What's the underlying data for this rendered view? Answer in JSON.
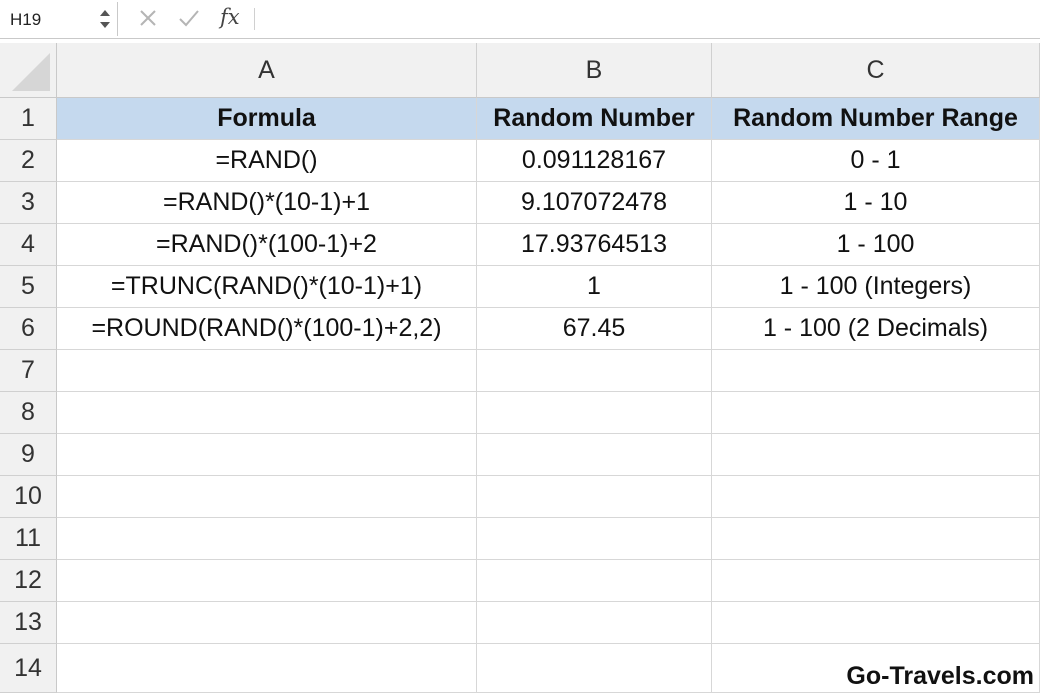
{
  "name_box": {
    "value": "H19"
  },
  "formula_bar": {
    "fx_label": "fx",
    "value": ""
  },
  "columns": [
    "A",
    "B",
    "C"
  ],
  "rows": [
    "1",
    "2",
    "3",
    "4",
    "5",
    "6",
    "7",
    "8",
    "9",
    "10",
    "11",
    "12",
    "13",
    "14"
  ],
  "table": {
    "header": [
      "Formula",
      "Random Number",
      "Random Number Range"
    ],
    "rows": [
      [
        "=RAND()",
        "0.091128167",
        "0 - 1"
      ],
      [
        "=RAND()*(10-1)+1",
        "9.107072478",
        "1 - 10"
      ],
      [
        "=RAND()*(100-1)+2",
        "17.93764513",
        "1 - 100"
      ],
      [
        "=TRUNC(RAND()*(10-1)+1)",
        "1",
        "1 - 100 (Integers)"
      ],
      [
        "=ROUND(RAND()*(100-1)+2,2)",
        "67.45",
        "1 - 100 (2 Decimals)"
      ]
    ]
  },
  "header_fill_color": "#c5d9ee",
  "watermark": "Go-Travels.com"
}
